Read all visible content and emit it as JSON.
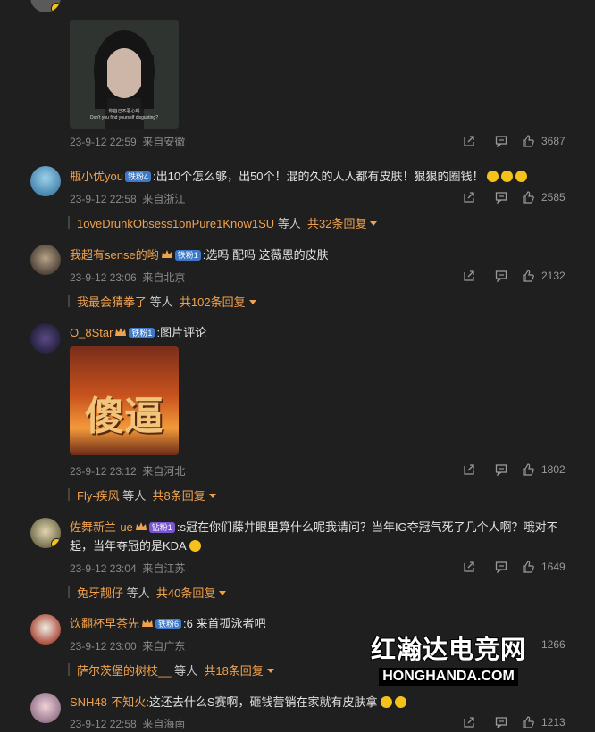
{
  "comments": [
    {
      "date": "23-9-12 22:59",
      "location": "来自安徽",
      "likes": "3687",
      "image_caption_cn": "你自己不恶心吗",
      "image_caption_en": "Don't you find yourself disgusting?"
    },
    {
      "username": "瓶小优you",
      "badge": "铁粉4",
      "text": "出10个怎么够，出50个！混的久的人人都有皮肤！狠狠的圈钱！",
      "date": "23-9-12 22:58",
      "location": "来自浙江",
      "likes": "2585",
      "replies": {
        "name": "1oveDrunkObsess1onPure1Know1SU",
        "mid": "等人",
        "count": "共32条回复"
      }
    },
    {
      "username": "我超有sense的哟",
      "badge": "铁粉1",
      "text": "选吗 配吗 这薇恩的皮肤",
      "date": "23-9-12 23:06",
      "location": "来自北京",
      "likes": "2132",
      "replies": {
        "name": "我最会猜拳了",
        "mid": "等人",
        "count": "共102条回复"
      }
    },
    {
      "username": "O_8Star",
      "badge": "铁粉1",
      "text": "图片评论",
      "date": "23-9-12 23:12",
      "location": "来自河北",
      "likes": "1802",
      "image_text": "傻逼",
      "replies": {
        "name": "Fly-疾风",
        "mid": "等人",
        "count": "共8条回复"
      }
    },
    {
      "username": "佐舞新兰-ue",
      "badge": "钻粉1",
      "text_line1": "s冠在你们藤井眼里算什么呢我请问？当年IG夺冠气死了几个人啊？哦对不",
      "text_line2": "起，当年夺冠的是KDA",
      "date": "23-9-12 23:04",
      "location": "来自江苏",
      "likes": "1649",
      "replies": {
        "name": "兔牙靓仔",
        "mid": "等人",
        "count": "共40条回复"
      }
    },
    {
      "username": "饮翻杯早茶先",
      "badge": "铁粉6",
      "text": "6 来首孤泳者吧",
      "date": "23-9-12 23:00",
      "location": "来自广东",
      "likes": "1266",
      "replies": {
        "name": "萨尔茨堡的树枝__",
        "mid": "等人",
        "count": "共18条回复"
      }
    },
    {
      "username": "SNH48-不知火",
      "text": "这还去什么S赛啊，砸钱营销在家就有皮肤拿",
      "date": "23-9-12 22:58",
      "location": "来自海南",
      "likes": "1213"
    }
  ],
  "watermark": {
    "cn": "红瀚达电竞网",
    "en": "HONGHANDA.COM"
  },
  "colors": {
    "background": "#1f1f1f",
    "username": "#f0a14e",
    "meta": "#8a8a8a"
  }
}
